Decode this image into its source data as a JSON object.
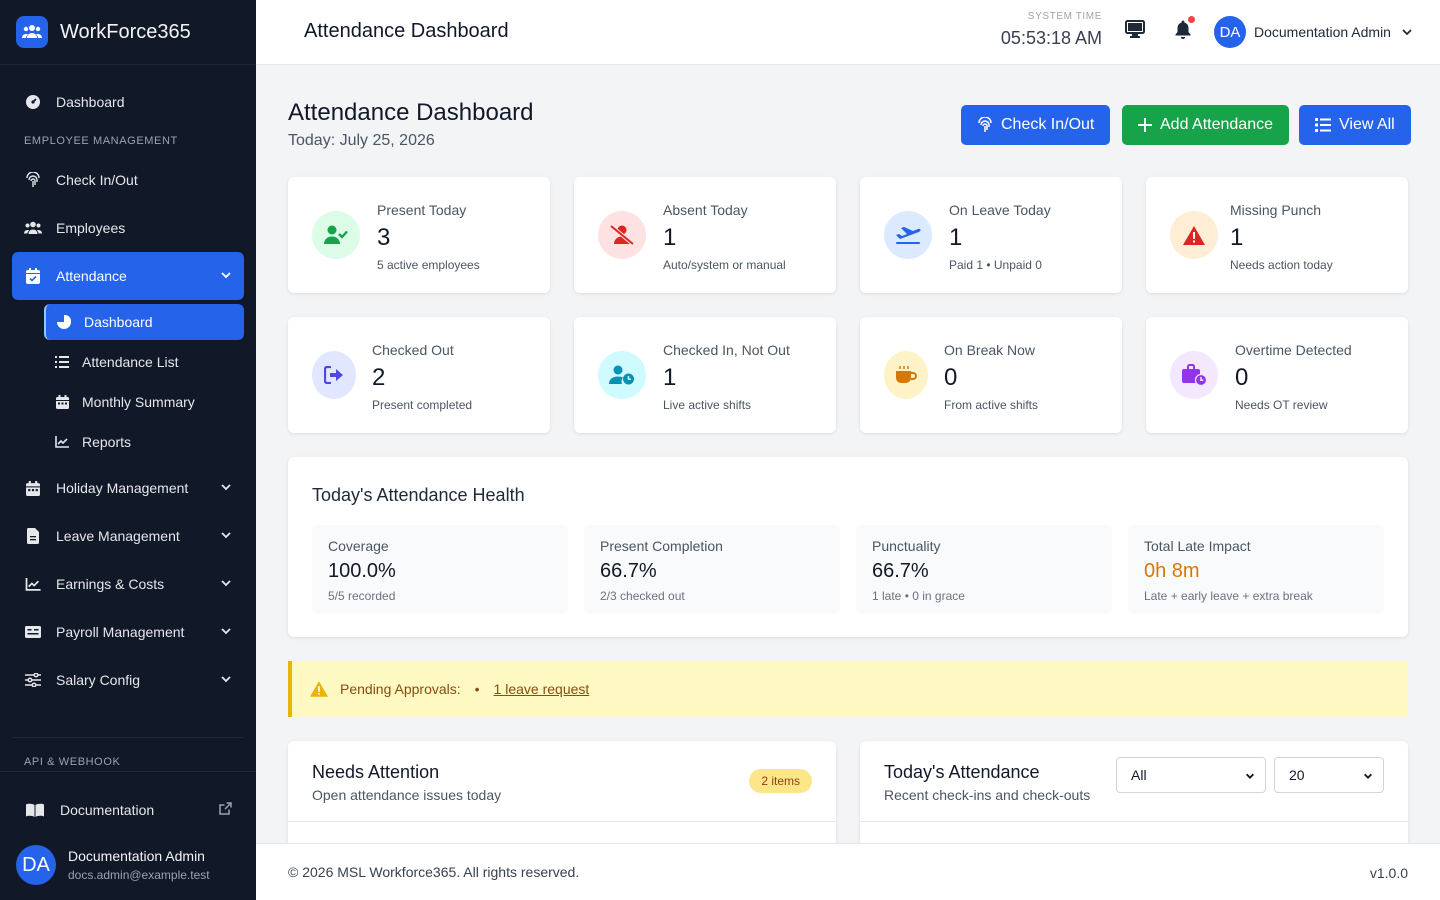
{
  "app": {
    "name": "WorkForce365"
  },
  "sidebar": {
    "dashboard": "Dashboard",
    "section_employee": "EMPLOYEE MANAGEMENT",
    "check_in_out": "Check In/Out",
    "employees": "Employees",
    "attendance": "Attendance",
    "attendance_sub": [
      "Dashboard",
      "Attendance List",
      "Monthly Summary",
      "Reports"
    ],
    "holiday": "Holiday Management",
    "leave": "Leave Management",
    "earnings": "Earnings & Costs",
    "payroll": "Payroll Management",
    "salary": "Salary Config",
    "section_api": "API & WEBHOOK",
    "documentation": "Documentation",
    "user": {
      "initials": "DA",
      "name": "Documentation Admin",
      "email": "docs.admin@example.test"
    }
  },
  "header": {
    "title": "Attendance Dashboard",
    "system_time_label": "SYSTEM TIME",
    "system_time": "05:53:18 AM",
    "user_initials": "DA",
    "user_name": "Documentation Admin"
  },
  "page": {
    "title": "Attendance Dashboard",
    "date": "Today: July 25, 2026",
    "buttons": {
      "check": "Check In/Out",
      "add": "Add Attendance",
      "view": "View All"
    }
  },
  "stats": [
    {
      "label": "Present Today",
      "value": "3",
      "sub": "5 active employees"
    },
    {
      "label": "Absent Today",
      "value": "1",
      "sub": "Auto/system or manual"
    },
    {
      "label": "On Leave Today",
      "value": "1",
      "sub": "Paid 1 • Unpaid 0"
    },
    {
      "label": "Missing Punch",
      "value": "1",
      "sub": "Needs action today"
    },
    {
      "label": "Checked Out",
      "value": "2",
      "sub": "Present completed"
    },
    {
      "label": "Checked In, Not Out",
      "value": "1",
      "sub": "Live active shifts"
    },
    {
      "label": "On Break Now",
      "value": "0",
      "sub": "From active shifts"
    },
    {
      "label": "Overtime Detected",
      "value": "0",
      "sub": "Needs OT review"
    }
  ],
  "health": {
    "title": "Today's Attendance Health",
    "items": [
      {
        "label": "Coverage",
        "value": "100.0%",
        "sub": "5/5 recorded"
      },
      {
        "label": "Present Completion",
        "value": "66.7%",
        "sub": "2/3 checked out"
      },
      {
        "label": "Punctuality",
        "value": "66.7%",
        "sub": "1 late • 0 in grace"
      },
      {
        "label": "Total Late Impact",
        "value": "0h 8m",
        "sub": "Late + early leave + extra break"
      }
    ]
  },
  "alert": {
    "label": "Pending Approvals:",
    "bullet": "•",
    "link": "1 leave request"
  },
  "needs_attention": {
    "title": "Needs Attention",
    "subtitle": "Open attendance issues today",
    "badge": "2 items"
  },
  "today_attendance": {
    "title": "Today's Attendance",
    "subtitle": "Recent check-ins and check-outs",
    "filter_value": "All",
    "page_size": "20"
  },
  "footer": {
    "copyright": "© 2026 MSL Workforce365. All rights reserved.",
    "version": "v1.0.0"
  },
  "colors": {
    "sidebar": "#111827",
    "primary": "#2563eb",
    "success": "#16a34a",
    "warning": "#eab308",
    "late_value": "#d97706"
  }
}
